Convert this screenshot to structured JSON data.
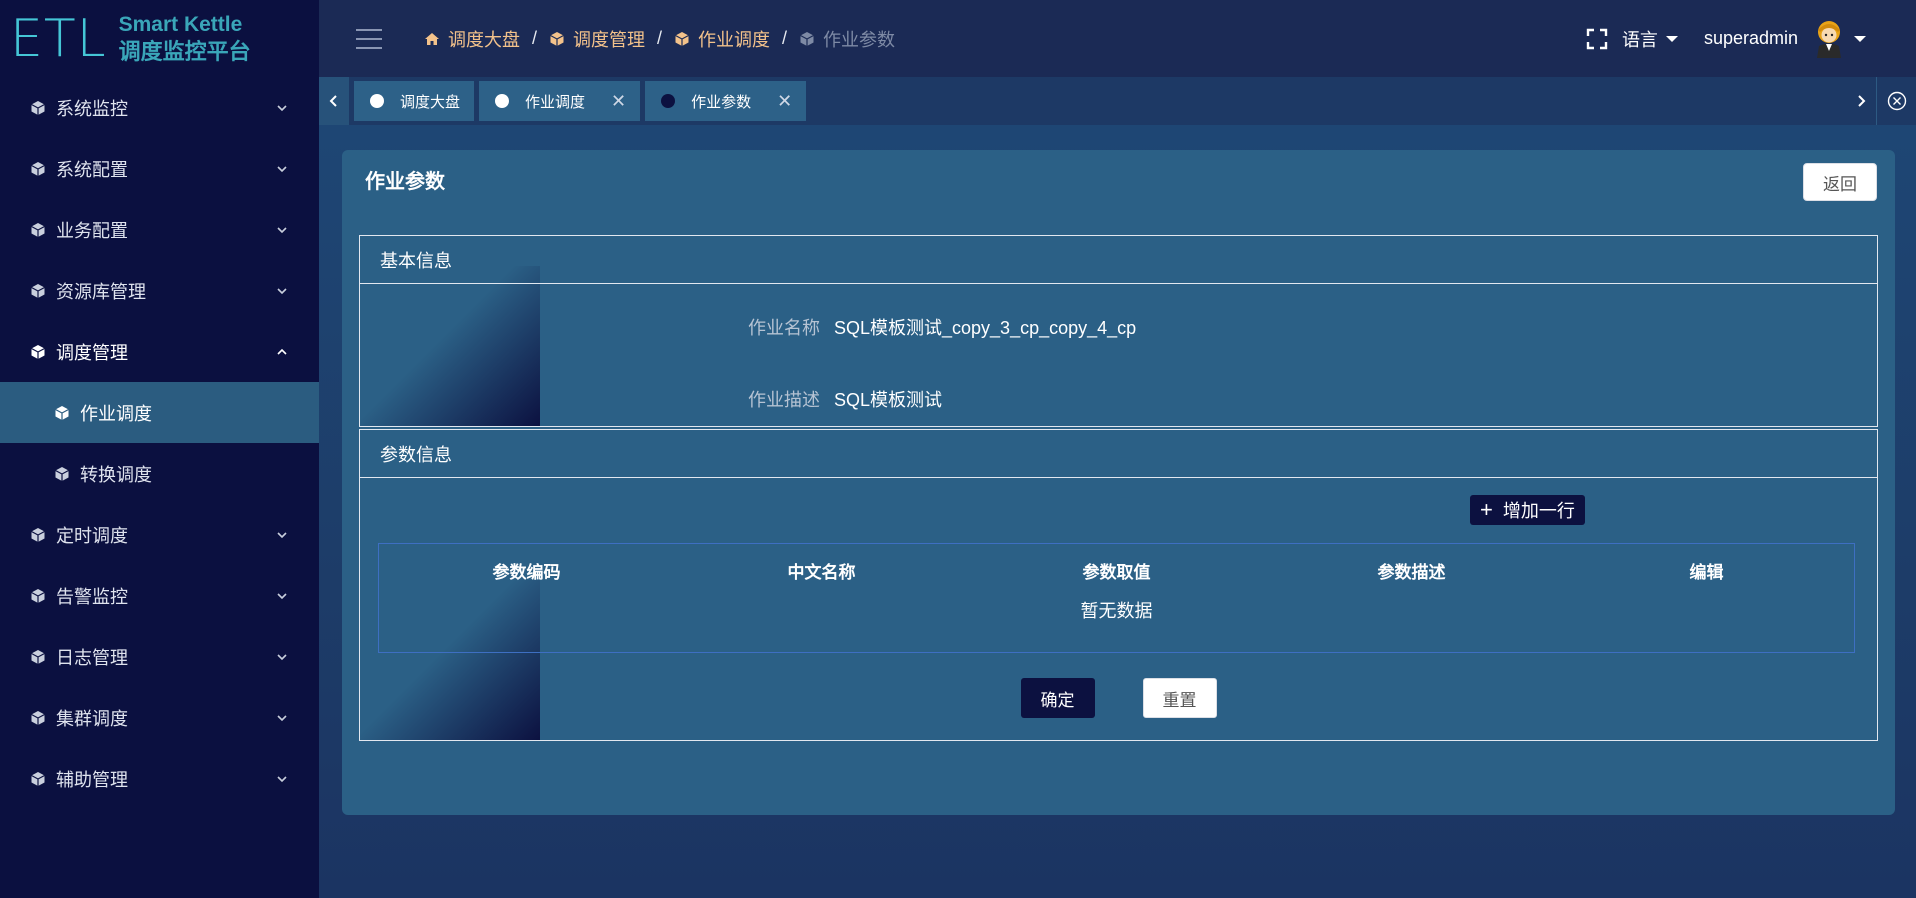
{
  "logo": {
    "mark": "ETL",
    "line1": "Smart Kettle",
    "line2": "调度监控平台"
  },
  "sidebar": {
    "items": [
      {
        "label": "系统监控",
        "icon": "cube-icon",
        "expanded": false
      },
      {
        "label": "系统配置",
        "icon": "cube-icon",
        "expanded": false
      },
      {
        "label": "业务配置",
        "icon": "cube-icon",
        "expanded": false
      },
      {
        "label": "资源库管理",
        "icon": "cube-icon",
        "expanded": false
      },
      {
        "label": "调度管理",
        "icon": "cube-icon",
        "expanded": true,
        "children": [
          {
            "label": "作业调度",
            "active": true
          },
          {
            "label": "转换调度",
            "active": false
          }
        ]
      },
      {
        "label": "定时调度",
        "icon": "cube-icon",
        "expanded": false
      },
      {
        "label": "告警监控",
        "icon": "cube-icon",
        "expanded": false
      },
      {
        "label": "日志管理",
        "icon": "cube-icon",
        "expanded": false
      },
      {
        "label": "集群调度",
        "icon": "cube-icon",
        "expanded": false
      },
      {
        "label": "辅助管理",
        "icon": "cube-icon",
        "expanded": false
      }
    ]
  },
  "header": {
    "breadcrumb": [
      {
        "label": "调度大盘",
        "icon": "home-icon"
      },
      {
        "label": "调度管理",
        "icon": "cube-icon"
      },
      {
        "label": "作业调度",
        "icon": "cube-icon"
      },
      {
        "label": "作业参数",
        "icon": "cube-icon",
        "current": true
      }
    ],
    "separator": "/",
    "language_label": "语言",
    "username": "superadmin"
  },
  "tabs": [
    {
      "label": "调度大盘",
      "active": false,
      "closable": false
    },
    {
      "label": "作业调度",
      "active": false,
      "closable": true
    },
    {
      "label": "作业参数",
      "active": true,
      "closable": true
    }
  ],
  "main": {
    "title": "作业参数",
    "back_label": "返回",
    "basic": {
      "heading": "基本信息",
      "name_label": "作业名称",
      "name_value": "SQL模板测试_copy_3_cp_copy_4_cp",
      "desc_label": "作业描述",
      "desc_value": "SQL模板测试"
    },
    "params": {
      "heading": "参数信息",
      "add_row_label": "增加一行",
      "columns": [
        "参数编码",
        "中文名称",
        "参数取值",
        "参数描述",
        "编辑"
      ],
      "empty_text": "暂无数据",
      "confirm_label": "确定",
      "reset_label": "重置"
    }
  },
  "colors": {
    "sidebar_bg": "#0b1040",
    "active_item_bg": "#2b5c80",
    "card_bg": "#2b6086",
    "accent_dark": "#0c1140",
    "breadcrumb_link": "#f3c28b",
    "logo": "#3aa6b9"
  }
}
